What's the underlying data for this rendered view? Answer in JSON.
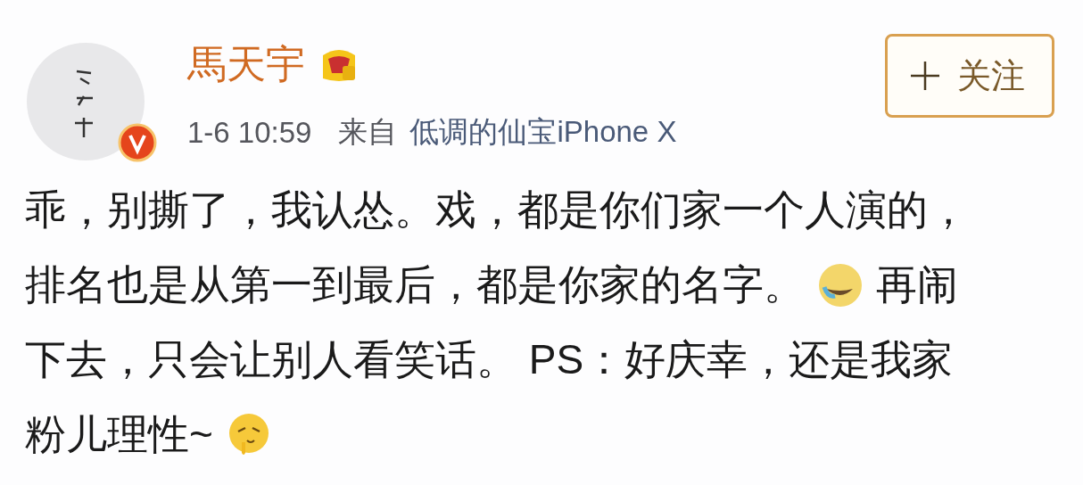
{
  "post": {
    "author": {
      "name": "馬天宇",
      "verified": true,
      "member_badge": true
    },
    "time": "1-6 10:59",
    "source_prefix": "来自",
    "source": "低调的仙宝iPhone X",
    "follow_button": {
      "label": "关注",
      "following": false
    },
    "body": [
      [
        {
          "kind": "text",
          "text": "乖，别撕了，我认怂。戏，都是你们家一个人演的，"
        }
      ],
      [
        {
          "kind": "text",
          "text": "排名也是从第一到最后，都是你家的名字。"
        },
        {
          "kind": "emoji"
        },
        {
          "kind": "text",
          "text": "再闹"
        }
      ],
      [
        {
          "kind": "text",
          "text": "下去，只会让别人看笑话。 PS：好庆幸，还是我家"
        }
      ],
      [
        {
          "kind": "text",
          "text": "粉儿理性~"
        },
        {
          "kind": "emoji2"
        }
      ]
    ]
  }
}
